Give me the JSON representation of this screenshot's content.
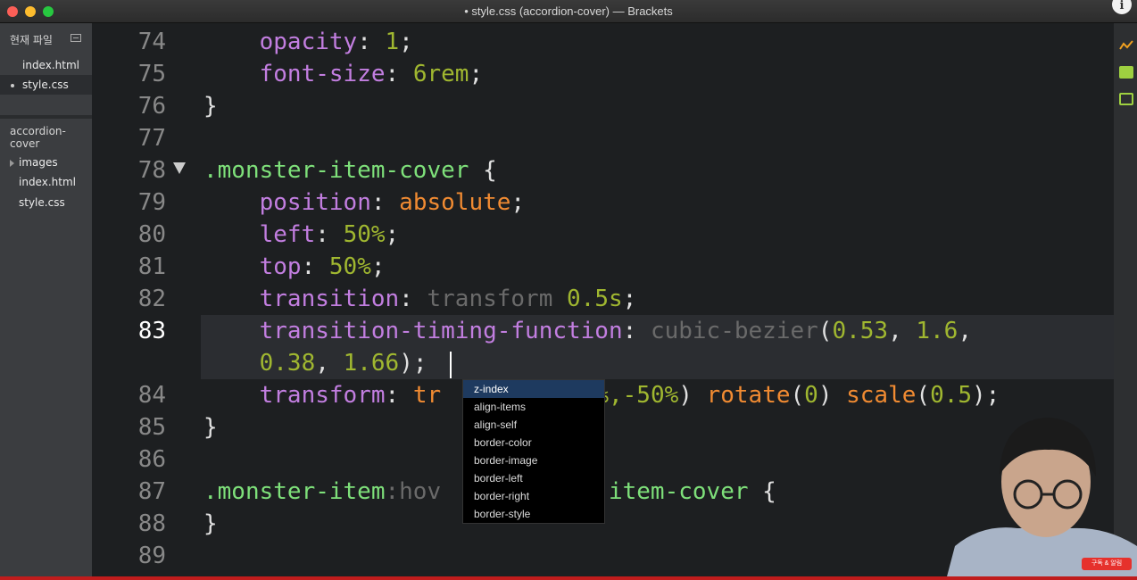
{
  "window": {
    "title": "• style.css (accordion-cover) — Brackets",
    "info_glyph": "i"
  },
  "sidebar": {
    "working_files_header": "현재 파일",
    "working_files": [
      {
        "label": "index.html",
        "active": false
      },
      {
        "label": "style.css",
        "active": true
      }
    ],
    "project_name": "accordion-cover",
    "tree": [
      "images",
      "index.html",
      "style.css"
    ]
  },
  "editor": {
    "lines": [
      {
        "n": "74",
        "y": 0
      },
      {
        "n": "75"
      },
      {
        "n": "76"
      },
      {
        "n": "77"
      },
      {
        "n": "78"
      },
      {
        "n": "79"
      },
      {
        "n": "80"
      },
      {
        "n": "81"
      },
      {
        "n": "82"
      },
      {
        "n": "83"
      },
      {
        "n": "84"
      },
      {
        "n": "85"
      },
      {
        "n": "86"
      },
      {
        "n": "87"
      },
      {
        "n": "88"
      },
      {
        "n": "89"
      }
    ],
    "code": {
      "l74_prop": "opacity",
      "l74_val": "1",
      "l75_prop": "font-size",
      "l75_val": "6rem",
      "l76": "}",
      "l78_sel": ".monster-item-cover",
      "l78_brace": "{",
      "l79_prop": "position",
      "l79_val": "absolute",
      "l80_prop": "left",
      "l80_val": "50%",
      "l81_prop": "top",
      "l81_val": "50%",
      "l82_prop": "transition",
      "l82_kw": "transform",
      "l82_val": "0.5s",
      "l83_prop": "transition-timing-function",
      "l83_fn": "cubic-bezier",
      "l83_a": "0.53",
      "l83_b": "1.6",
      "l83_c": "0.38",
      "l83_d": "1.66",
      "l84_prop": "transform",
      "l84_partial": "tr",
      "l84_args": "50%,-50%",
      "l84_rot": "rotate",
      "l84_rot_arg": "0",
      "l84_scale": "scale",
      "l84_scale_arg": "0.5",
      "l85": "}",
      "l87_sel": ".monster-item",
      "l87_pseudo": ":hov",
      "l87_rest": "er-item-cover",
      "l87_brace": "{",
      "l88": "}"
    }
  },
  "code_hints": [
    "z-index",
    "align-items",
    "align-self",
    "border-color",
    "border-image",
    "border-left",
    "border-right",
    "border-style"
  ],
  "overlay": {
    "badge_text": "구독 & 알림"
  },
  "icons": [
    "live-preview-icon",
    "extension-manager-icon",
    "gift-icon"
  ]
}
